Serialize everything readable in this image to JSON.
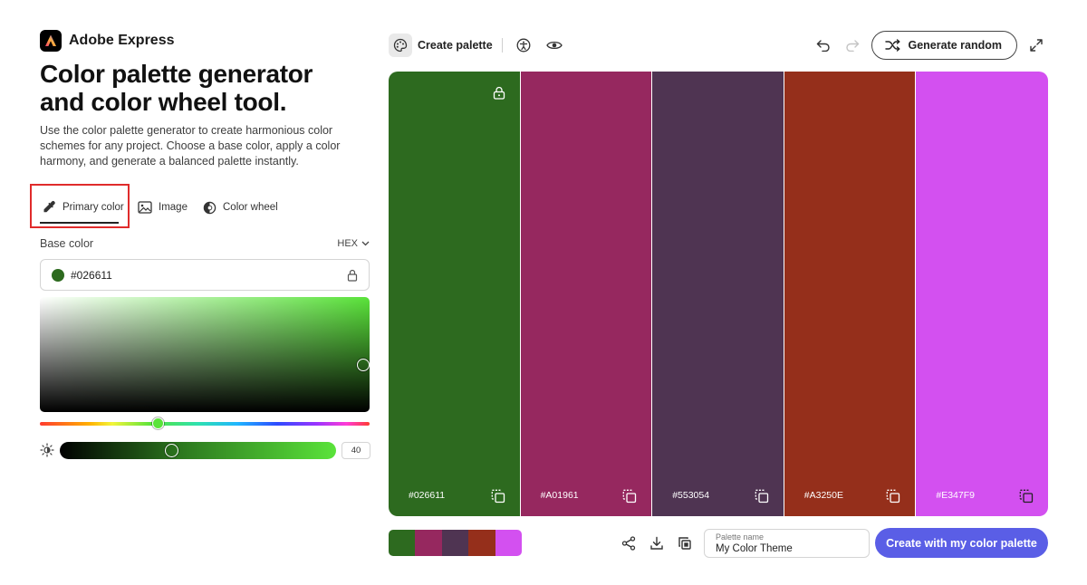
{
  "brand": {
    "name": "Adobe Express"
  },
  "hero": {
    "title_line1": "Color palette generator",
    "title_line2": "and color wheel tool.",
    "description": "Use the color palette generator to create harmonious color schemes for any project. Choose a base color, apply a color harmony, and generate a balanced palette instantly."
  },
  "modes": {
    "primary": "Primary color",
    "image": "Image",
    "wheel": "Color wheel",
    "active": "primary"
  },
  "base_color": {
    "label": "Base color",
    "format": "HEX",
    "value": "#026611",
    "swatch": "#2d6a1f"
  },
  "brightness": {
    "value": "40"
  },
  "toolbar": {
    "create_label": "Create palette",
    "generate_label": "Generate random"
  },
  "palette": [
    {
      "hex": "#026611",
      "color": "#2d6a1f",
      "locked": true
    },
    {
      "hex": "#A01961",
      "color": "#96285f",
      "locked": false
    },
    {
      "hex": "#553054",
      "color": "#4f3452",
      "locked": false
    },
    {
      "hex": "#A3250E",
      "color": "#952f1b",
      "locked": false
    },
    {
      "hex": "#E347F9",
      "color": "#d350f0",
      "locked": false
    }
  ],
  "bottom": {
    "name_label": "Palette name",
    "name_value": "My Color Theme",
    "cta_label": "Create with my color palette"
  },
  "colors": {
    "accent": "#5a5ee6",
    "highlight": "#e02b2b"
  },
  "icons": {
    "eyedropper": "eyedropper-icon",
    "image": "image-icon",
    "wheel": "color-wheel-icon",
    "lock": "lock-icon",
    "copy": "copy-icon",
    "share": "share-icon",
    "download": "download-icon",
    "duplicate": "duplicate-icon",
    "undo": "undo-icon",
    "redo": "redo-icon",
    "shuffle": "shuffle-icon",
    "expand": "expand-icon",
    "accessibility": "accessibility-icon",
    "eye": "eye-icon",
    "sun": "brightness-icon"
  }
}
